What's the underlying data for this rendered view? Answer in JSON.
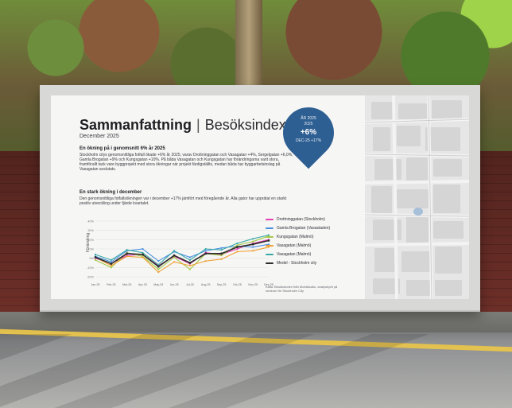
{
  "poster": {
    "title": "Sammanfattning",
    "subtitle": "Besöksindex",
    "date": "December 2025",
    "section1": {
      "heading": "En ökning på i genomsnitt 6% år 2025",
      "body": "Stockholm citys genomsnittliga fotfall ökade +6% år 2025, varav Drottninggatan och Vasagatan +4%, Sergelgatan +6,0%, Gamla Brogatan +9% och Kungsgatan +10%. På båda Vasagatan och Kungsgatan har förändringarna varit stora, framförallt tack vare byggprojekt med stora ökningar när projekt färdigställts, medan båda har byggarbetsinslag på Vasagatan avslutats."
    },
    "section2": {
      "heading": "En stark ökning i december",
      "body": "Den genomsnittliga fotfallsökningen var i december +17% jämfört med föregående år. Alla gator har upprätat en starkt positiv utveckling under fjärde kvartalet."
    },
    "badge": {
      "line1": "ÅR 2025",
      "line2": "2025",
      "value": "+6%",
      "line4": "DEC-25 +17%"
    },
    "footnote": "Källa: Besöksindex från Mobilstudio, analysbyrå på centrum för Stockholm City"
  },
  "colors": {
    "series1": "#e53eb0",
    "series2": "#4a8fe0",
    "series3": "#a6c948",
    "series4": "#f0a132",
    "series5": "#39a9a6",
    "series6": "#2d2d2d",
    "badge": "#2e5f93"
  },
  "chart_data": {
    "type": "line",
    "x": [
      "Jan-25",
      "Feb-25",
      "Mar-25",
      "Apr-25",
      "May-25",
      "Jun-25",
      "Jul-25",
      "Aug-25",
      "Sep-25",
      "Oct-25",
      "Nov-25",
      "Dec-25"
    ],
    "ylabel": "Förändring",
    "ylim": [
      -20,
      40
    ],
    "series": [
      {
        "name": "Drottninggatan (Stockholm)",
        "values": [
          0,
          -6,
          3,
          4,
          -8,
          2,
          -6,
          6,
          4,
          10,
          16,
          20
        ]
      },
      {
        "name": "Gamla Brogatan (Vasastaden)",
        "values": [
          2,
          -4,
          8,
          10,
          -3,
          7,
          1,
          8,
          11,
          13,
          12,
          15
        ]
      },
      {
        "name": "Kungsgatan (Malmö)",
        "values": [
          -2,
          -10,
          6,
          2,
          -12,
          1,
          -12,
          5,
          3,
          14,
          18,
          24
        ]
      },
      {
        "name": "Vasagatan (Malmö)",
        "values": [
          1,
          -8,
          2,
          1,
          -15,
          -4,
          -8,
          -3,
          -1,
          7,
          8,
          12
        ]
      },
      {
        "name": "Vasagatan (Malmö)",
        "values": [
          4,
          -2,
          9,
          6,
          -7,
          8,
          -2,
          10,
          9,
          16,
          21,
          25
        ]
      },
      {
        "name": "Medel - Stockholm city",
        "values": [
          1,
          -6,
          5,
          4,
          -9,
          3,
          -5,
          5,
          5,
          12,
          15,
          19
        ]
      }
    ],
    "grid": true,
    "legend": "right"
  }
}
